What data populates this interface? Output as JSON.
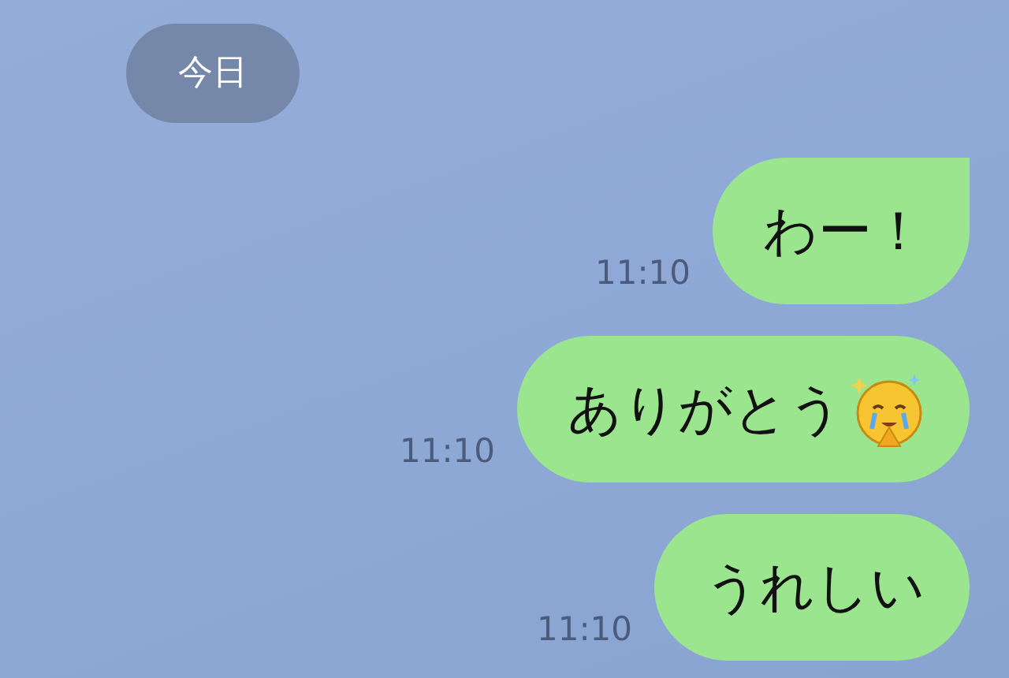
{
  "date_label": "今日",
  "messages": [
    {
      "text": "わー！",
      "time": "11:10",
      "tail": true,
      "has_emoji": false
    },
    {
      "text": "ありがとう",
      "time": "11:10",
      "tail": false,
      "has_emoji": true
    },
    {
      "text": "うれしい",
      "time": "11:10",
      "tail": false,
      "has_emoji": false
    }
  ]
}
